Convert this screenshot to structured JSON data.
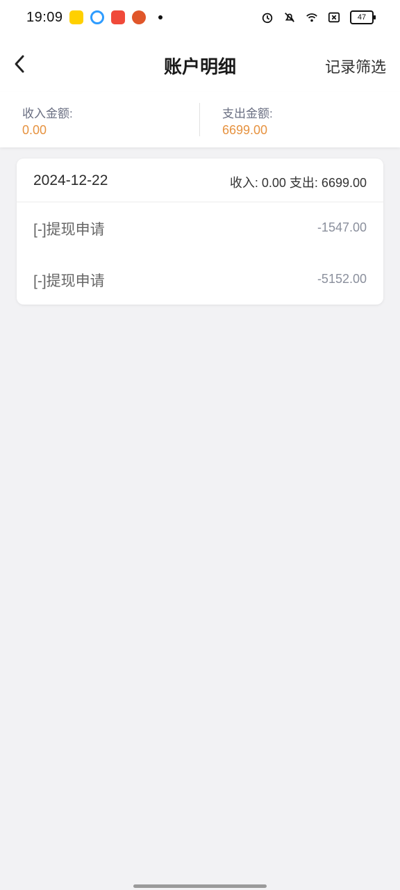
{
  "status_bar": {
    "time": "19:09",
    "battery": "47",
    "app_icons": [
      "meituan-icon",
      "chat-bubble-icon",
      "video-player-icon",
      "pumpkin-app-icon"
    ],
    "system_icons": [
      "alarm-icon",
      "mute-icon",
      "wifi-icon",
      "sim-x-icon",
      "battery-icon"
    ]
  },
  "header": {
    "title": "账户明细",
    "back_icon": "chevron-left-icon",
    "filter_label": "记录筛选"
  },
  "summary": {
    "income_label": "收入金额:",
    "income_value": "0.00",
    "expense_label": "支出金额:",
    "expense_value": "6699.00"
  },
  "day_group": {
    "date": "2024-12-22",
    "totals_text": "收入: 0.00 支出: 6699.00",
    "records": [
      {
        "title": "[-]提现申请",
        "amount": "-1547.00"
      },
      {
        "title": "[-]提现申请",
        "amount": "-5152.00"
      }
    ]
  },
  "colors": {
    "accent_orange": "#e6923f",
    "background": "#f2f2f4",
    "label_gray": "#6a6f82"
  }
}
